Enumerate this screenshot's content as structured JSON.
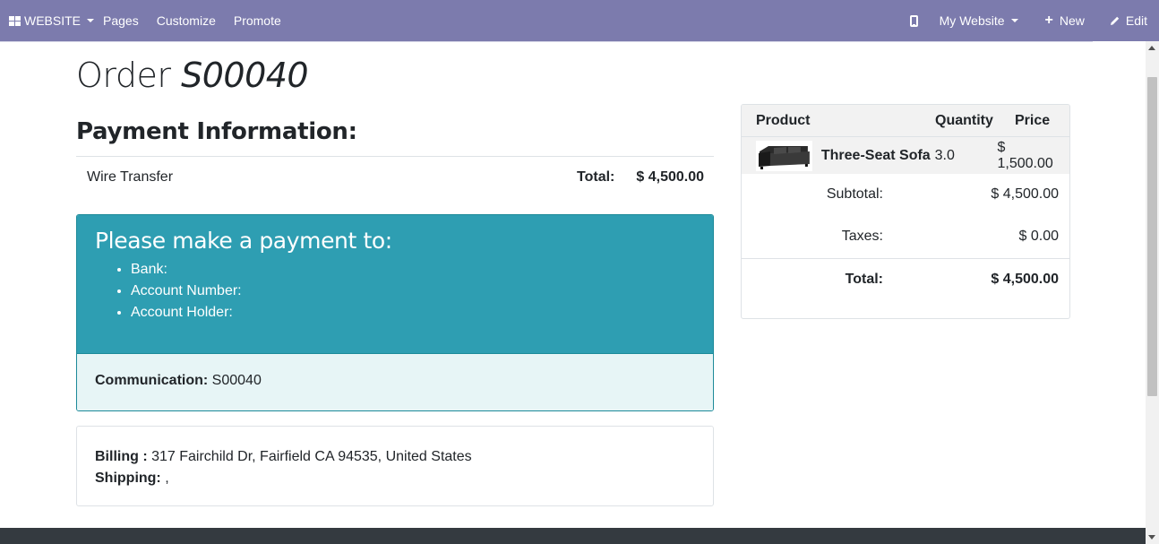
{
  "navbar": {
    "brand_label": "WEBSITE",
    "menu": [
      "Pages",
      "Customize",
      "Promote"
    ],
    "my_website_label": "My Website",
    "new_label": "New",
    "edit_label": "Edit",
    "bg_color": "#7c7bad"
  },
  "order": {
    "title_prefix": "Order",
    "number": "S00040"
  },
  "payment": {
    "heading": "Payment Information:",
    "method": "Wire Transfer",
    "total_label": "Total:",
    "total_value": "$ 4,500.00"
  },
  "instructions": {
    "heading": "Please make a payment to:",
    "items": [
      "Bank:",
      "Account Number:",
      "Account Holder:"
    ],
    "communication_label": "Communication:",
    "communication_value": "S00040",
    "color": "#2e9eb2"
  },
  "address": {
    "billing_label": "Billing :",
    "billing_value": "317 Fairchild Dr, Fairfield CA 94535, United States",
    "shipping_label": "Shipping:",
    "shipping_value": ","
  },
  "cart": {
    "headers": {
      "product": "Product",
      "quantity": "Quantity",
      "price": "Price"
    },
    "lines": [
      {
        "product": "Three-Seat Sofa",
        "quantity": "3.0",
        "price": "$ 1,500.00",
        "image": "sofa-icon"
      }
    ],
    "subtotal_label": "Subtotal:",
    "subtotal_value": "$ 4,500.00",
    "taxes_label": "Taxes:",
    "taxes_value": "$ 0.00",
    "total_label": "Total:",
    "total_value": "$ 4,500.00"
  }
}
